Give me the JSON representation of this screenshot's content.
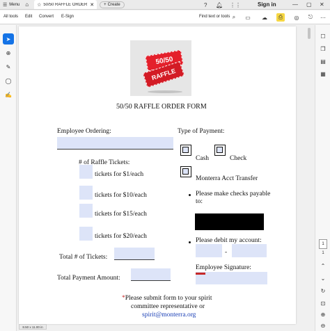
{
  "tabbar": {
    "menu_label": "Menu",
    "tab_title": "50/50 RAFFLE ORDER FORM",
    "create_label": "Create",
    "signin_label": "Sign in"
  },
  "toolbar": {
    "all_tools": "All tools",
    "edit": "Edit",
    "convert": "Convert",
    "esign": "E-Sign",
    "find_placeholder": "Find text or tools"
  },
  "logo": {
    "ticket_top": "50/50",
    "ticket_bottom": "RAFFLE"
  },
  "form": {
    "title": "50/50 RAFFLE ORDER FORM",
    "employee_ordering": "Employee Ordering:",
    "type_of_payment": "Type of Payment:",
    "cash": "Cash",
    "check": "Check",
    "num_tickets": "# of Raffle Tickets:",
    "tickets_1": "tickets for $1/each",
    "tickets_10": "tickets for $10/each",
    "tickets_15": "tickets for $15/each",
    "tickets_20": "tickets for $20/each",
    "monterra_acct": "Monterra Acct Transfer",
    "checks_payable_1": "Please make checks payable",
    "checks_payable_2": "to:",
    "debit_account": "Please debit my account:",
    "debit_dash": "-",
    "total_tickets": "Total # of Tickets:",
    "employee_signature": "Employee Signature:",
    "total_payment": "Total Payment Amount:",
    "submit_star": "*",
    "submit_1": "Please submit form to your spirit",
    "submit_2": "committee representative or",
    "email": "spirit@monterra.org"
  },
  "status": {
    "page_size": "8.50 x 11.00 in",
    "page_number": "1",
    "page_total": "1"
  },
  "colors": {
    "field_fill": "#dde4f8",
    "accent_blue": "#1473e6",
    "ticket_red": "#e4202b"
  }
}
